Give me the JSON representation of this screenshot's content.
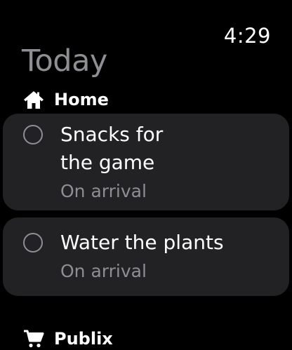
{
  "status_bar": {
    "time": "4:29"
  },
  "header": {
    "title": "Today"
  },
  "sections": [
    {
      "label": "Home",
      "icon": "house-icon",
      "items": [
        {
          "title_line1": "Snacks for",
          "title_line2": "the game",
          "subtitle": "On arrival",
          "completed": false
        },
        {
          "title": "Water the plants",
          "subtitle": "On arrival",
          "completed": false
        }
      ]
    },
    {
      "label": "Publix",
      "icon": "cart-icon",
      "items": []
    }
  ],
  "colors": {
    "background": "#000000",
    "card": "#222224",
    "secondary_text": "#8e8e93",
    "primary_text": "#ffffff"
  }
}
